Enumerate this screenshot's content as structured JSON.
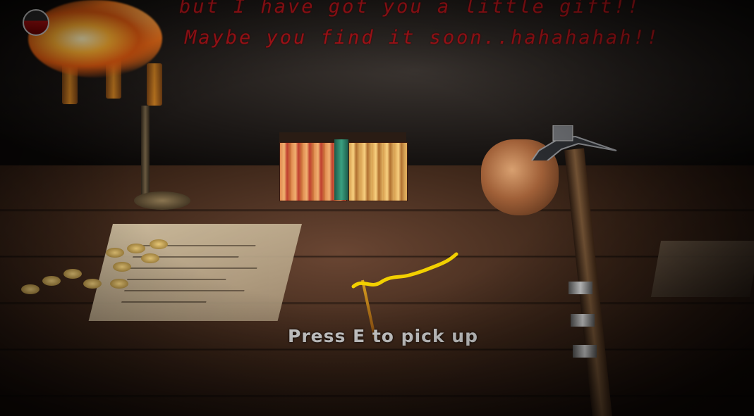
{
  "hud": {
    "message_line1": "but I have got you a little gift!!",
    "message_line2": "Maybe you find it soon..hahahahah!!",
    "health_fill": 0.58,
    "health_color": "#b01010",
    "prompt": "Press E to pick up"
  },
  "colors": {
    "message": "#b0141a",
    "prompt": "#d8d8d8"
  }
}
